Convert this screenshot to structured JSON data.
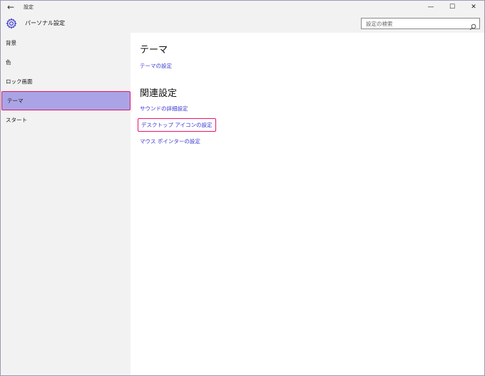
{
  "titlebar": {
    "title": "設定",
    "back_glyph": "←",
    "minimize_glyph": "—",
    "maximize_glyph": "☐",
    "close_glyph": "✕"
  },
  "header": {
    "title": "パーソナル設定",
    "search_placeholder": "設定の検索"
  },
  "sidebar": {
    "items": [
      {
        "label": "背景"
      },
      {
        "label": "色"
      },
      {
        "label": "ロック画面"
      },
      {
        "label": "テーマ"
      },
      {
        "label": "スタート"
      }
    ],
    "selected_index": 3
  },
  "main": {
    "section1_title": "テーマ",
    "theme_settings_link": "テーマの設定",
    "section2_title": "関連設定",
    "related_links": [
      {
        "label": "サウンドの詳細設定"
      },
      {
        "label": "デスクトップ アイコンの設定"
      },
      {
        "label": "マウス ポインターの設定"
      }
    ]
  },
  "colors": {
    "link": "#3b3bd4",
    "selected_bg": "#aaa4e6",
    "highlight_border": "#e8156a",
    "chrome_bg": "#f2f2f2"
  }
}
